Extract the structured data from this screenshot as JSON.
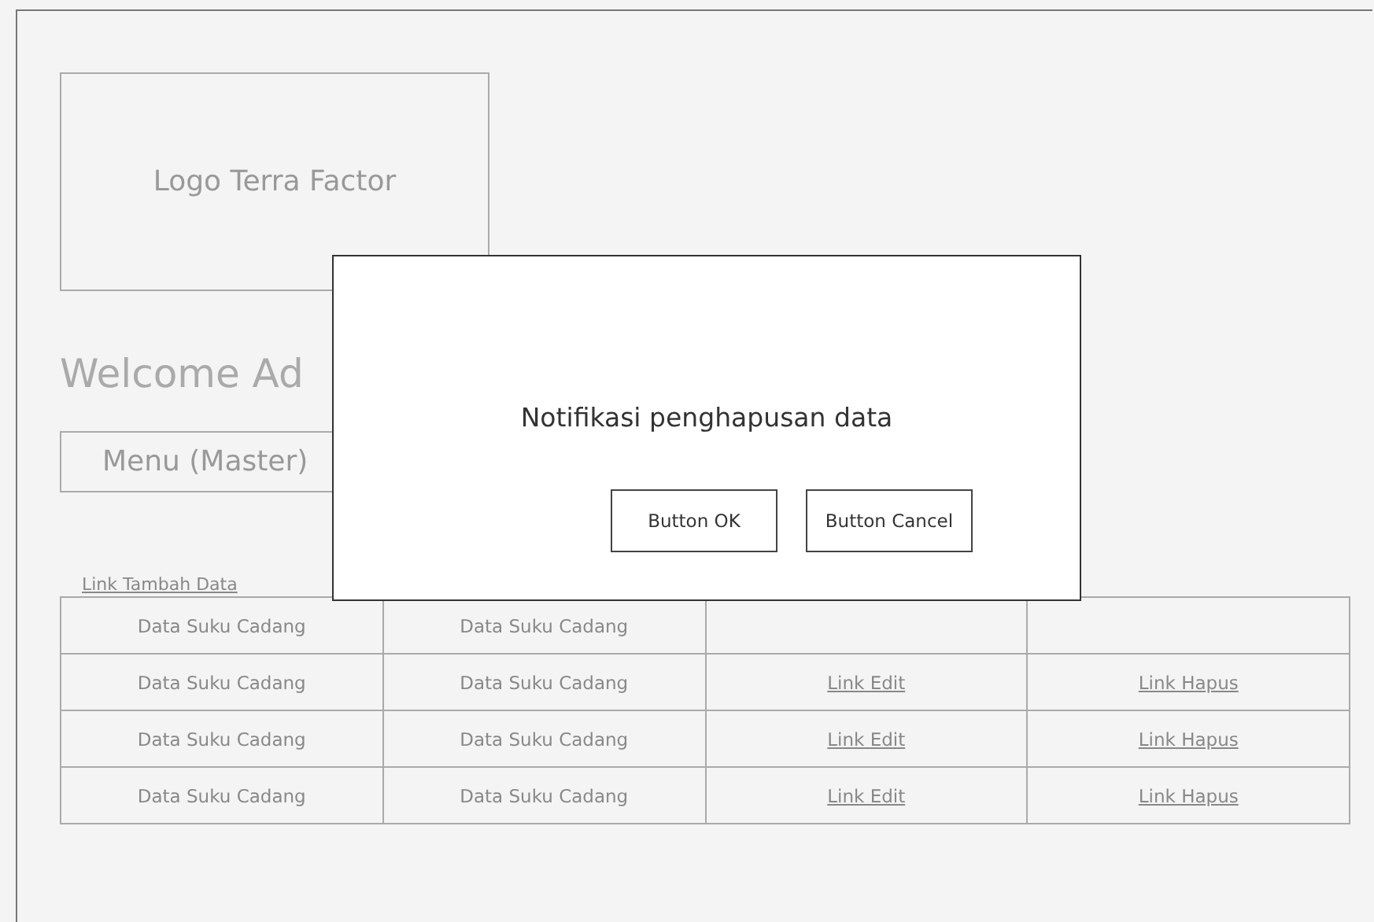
{
  "logo": {
    "label": "Logo Terra Factor"
  },
  "welcome": "Welcome Ad",
  "menu": {
    "label": "Menu (Master)"
  },
  "add_link": "Link Tambah Data",
  "table": {
    "rows": [
      [
        {
          "kind": "text",
          "text": "Data Suku Cadang"
        },
        {
          "kind": "text",
          "text": "Data Suku Cadang"
        },
        {
          "kind": "blank"
        },
        {
          "kind": "blank"
        }
      ],
      [
        {
          "kind": "text",
          "text": "Data Suku Cadang"
        },
        {
          "kind": "text",
          "text": "Data Suku Cadang"
        },
        {
          "kind": "link",
          "text": "Link Edit"
        },
        {
          "kind": "link",
          "text": "Link Hapus"
        }
      ],
      [
        {
          "kind": "text",
          "text": "Data Suku Cadang"
        },
        {
          "kind": "text",
          "text": "Data Suku Cadang"
        },
        {
          "kind": "link",
          "text": "Link Edit"
        },
        {
          "kind": "link",
          "text": "Link Hapus"
        }
      ],
      [
        {
          "kind": "text",
          "text": "Data Suku Cadang"
        },
        {
          "kind": "text",
          "text": "Data Suku Cadang"
        },
        {
          "kind": "link",
          "text": "Link Edit"
        },
        {
          "kind": "link",
          "text": "Link Hapus"
        }
      ]
    ]
  },
  "dialog": {
    "message": "Notifikasi penghapusan data",
    "buttons": [
      "Button OK",
      "Button Cancel"
    ]
  }
}
